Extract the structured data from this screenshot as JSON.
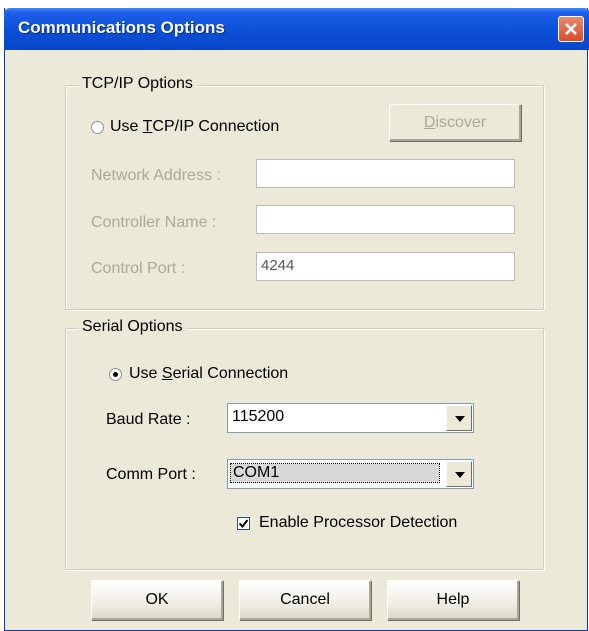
{
  "window": {
    "title": "Communications Options"
  },
  "tcp": {
    "legend": "TCP/IP Options",
    "radio_label_pre": "Use ",
    "radio_label_ul": "T",
    "radio_label_post": "CP/IP Connection",
    "discover_ul": "D",
    "discover_rest": "iscover",
    "network_address_label": "Network Address :",
    "network_address_value": "",
    "controller_name_label": "Controller Name :",
    "controller_name_value": "",
    "control_port_label": "Control Port :",
    "control_port_value": "4244"
  },
  "serial": {
    "legend": "Serial Options",
    "radio_label_pre": "Use ",
    "radio_label_ul": "S",
    "radio_label_post": "erial Connection",
    "baud_label": "Baud Rate :",
    "baud_value": "115200",
    "comm_label": "Comm Port :",
    "comm_value": "COM1",
    "detect_label": "Enable Processor Detection",
    "detect_checked": true
  },
  "buttons": {
    "ok": "OK",
    "cancel": "Cancel",
    "help": "Help"
  },
  "colors": {
    "titlebar": "#0c4fd8",
    "face": "#ece9d8",
    "close": "#d84c2a"
  },
  "icons": {
    "close": "close-icon",
    "dropdown": "chevron-down-icon",
    "check": "check-icon"
  }
}
